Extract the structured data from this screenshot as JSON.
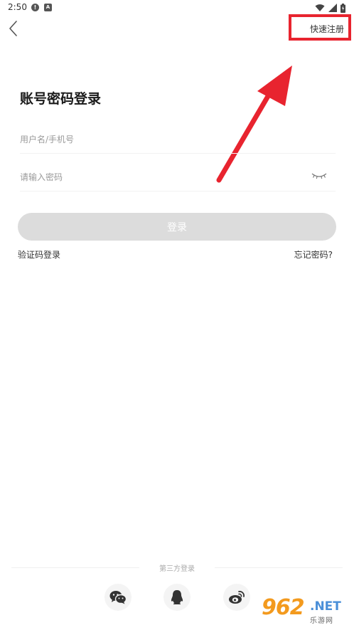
{
  "status_bar": {
    "time": "2:50",
    "alert_glyph": "!",
    "app_glyph": "A"
  },
  "header": {
    "register_label": "快速注册"
  },
  "form": {
    "title": "账号密码登录",
    "username_placeholder": "用户名/手机号",
    "password_placeholder": "请输入密码",
    "login_label": "登录",
    "sms_login_label": "验证码登录",
    "forgot_label": "忘记密码?"
  },
  "third_party": {
    "label": "第三方登录",
    "providers": [
      "wechat-icon",
      "qq-icon",
      "weibo-icon"
    ]
  },
  "watermark": {
    "number": "962",
    "suffix": ".NET",
    "sub": "乐游网"
  },
  "colors": {
    "highlight": "#e8242f",
    "button_disabled": "#dcdcdc",
    "watermark_orange": "#f39a1e",
    "watermark_blue": "#4a8fd8"
  }
}
